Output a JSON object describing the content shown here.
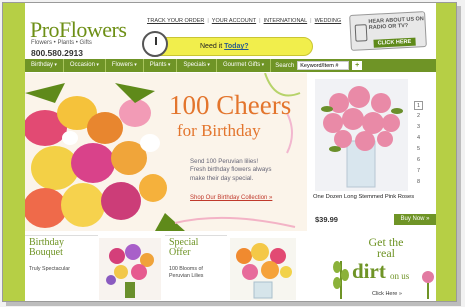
{
  "brand": {
    "logo": "ProFlowers",
    "tagline": "Flowers • Plants • Gifts",
    "phone": "800.580.2913"
  },
  "top_links": [
    "TRACK YOUR ORDER",
    "YOUR ACCOUNT",
    "INTERNATIONAL",
    "WEDDING"
  ],
  "need_it": {
    "prefix": "Need it",
    "link": "Today?"
  },
  "promo_radio": {
    "text": "HEAR ABOUT US ON RADIO OR TV?",
    "cta": "CLICK HERE"
  },
  "nav": {
    "items": [
      "Birthday",
      "Occasion",
      "Flowers",
      "Plants",
      "Specials",
      "Gourmet Gifts"
    ],
    "search_label": "Search",
    "search_value": "Keyword/Item #",
    "go": "+"
  },
  "hero": {
    "headline_line1": "100 Cheers",
    "headline_line2": "for Birthday",
    "copy_line1": "Send 100 Peruvian lilies!",
    "copy_line2": "Fresh birthday flowers always",
    "copy_line3": "make their day special.",
    "link": "Shop Our Birthday Collection »"
  },
  "product": {
    "name": "One Dozen Long Stemmed Pink Roses",
    "price": "$39.99",
    "buy": "Buy Now »",
    "pages": [
      "1",
      "2",
      "3",
      "4",
      "5",
      "6",
      "7",
      "8"
    ]
  },
  "bottom": {
    "card1_title_line1": "Birthday",
    "card1_title_line2": "Bouquet",
    "card1_sub": "Truly Spectacular",
    "card2_title_line1": "Special",
    "card2_title_line2": "Offer",
    "card2_sub_line1": "100 Blooms of",
    "card2_sub_line2": "Peruvian Lilies",
    "dirt_line1": "Get the",
    "dirt_line2": "real",
    "dirt_line3": "dirt",
    "dirt_line4": "on us",
    "dirt_cta": "Click Here »"
  },
  "colors": {
    "accent": "#6f9426",
    "hero_text": "#e3752d",
    "band": "#b6cf45"
  }
}
